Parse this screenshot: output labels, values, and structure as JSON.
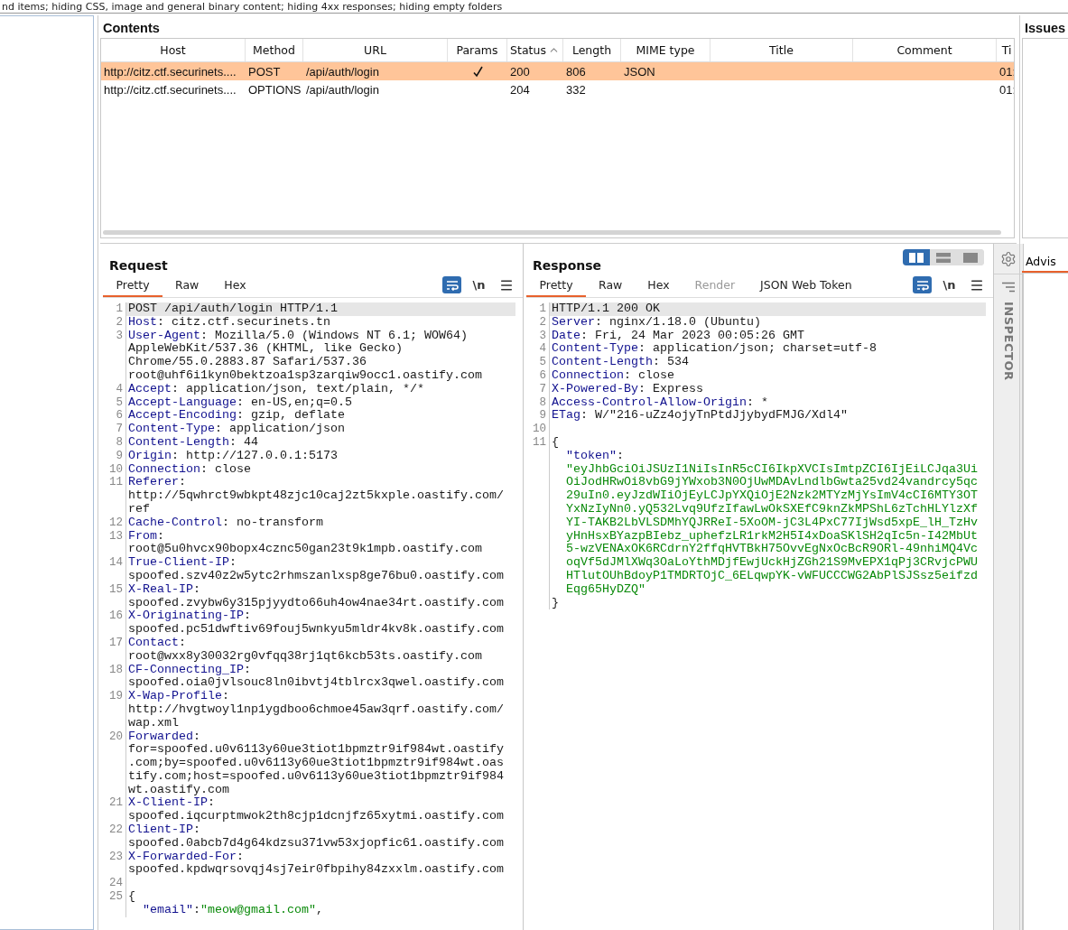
{
  "filter_bar": {
    "text": "nd items;  hiding CSS, image and general binary content;  hiding 4xx responses;  hiding empty folders"
  },
  "contents": {
    "title": "Contents",
    "table": {
      "columns": [
        {
          "label": "Host",
          "sorted": false
        },
        {
          "label": "Method",
          "sorted": false
        },
        {
          "label": "URL",
          "sorted": false
        },
        {
          "label": "Params",
          "sorted": false
        },
        {
          "label": "Status",
          "sorted": true
        },
        {
          "label": "Length",
          "sorted": false
        },
        {
          "label": "MIME type",
          "sorted": false
        },
        {
          "label": "Title",
          "sorted": false
        },
        {
          "label": "Comment",
          "sorted": false
        },
        {
          "label": "Ti",
          "sorted": false
        }
      ],
      "rows": [
        {
          "selected": true,
          "host": "http://citz.ctf.securinets....",
          "method": "POST",
          "url": "/api/auth/login",
          "params": true,
          "status": "200",
          "length": "806",
          "mime_type": "JSON",
          "time": "01:"
        },
        {
          "selected": false,
          "host": "http://citz.ctf.securinets....",
          "method": "OPTIONS",
          "url": "/api/auth/login",
          "params": false,
          "status": "204",
          "length": "332",
          "time": "01:"
        }
      ]
    }
  },
  "issues": {
    "title": "Issues",
    "tab": "Advis"
  },
  "layout_buttons": [
    {
      "kind": "columns",
      "selected": true
    },
    {
      "kind": "rows",
      "selected": false
    },
    {
      "kind": "single",
      "selected": false
    }
  ],
  "request": {
    "title": "Request",
    "tabs": [
      {
        "label": "Pretty",
        "selected": true,
        "disabled": false
      },
      {
        "label": "Raw",
        "selected": false,
        "disabled": false
      },
      {
        "label": "Hex",
        "selected": false,
        "disabled": false
      }
    ],
    "wrap_on": true,
    "newline_label": "\\n",
    "lines": [
      {
        "number": "1",
        "highlighted": true,
        "rows": [
          [
            {
              "kind": "plain",
              "text": "POST /api/auth/login HTTP/1.1"
            }
          ]
        ]
      },
      {
        "number": "2",
        "highlighted": false,
        "rows": [
          [
            {
              "kind": "name",
              "text": "Host"
            },
            {
              "kind": "plain",
              "text": ": citz.ctf.securinets.tn"
            }
          ]
        ]
      },
      {
        "number": "3",
        "highlighted": false,
        "rows": [
          [
            {
              "kind": "name",
              "text": "User-Agent"
            },
            {
              "kind": "plain",
              "text": ": Mozilla/5.0 (Windows NT 6.1; WOW64)"
            }
          ],
          [
            {
              "kind": "plain",
              "text": "AppleWebKit/537.36 (KHTML, like Gecko)"
            }
          ],
          [
            {
              "kind": "plain",
              "text": "Chrome/55.0.2883.87 Safari/537.36"
            }
          ],
          [
            {
              "kind": "plain",
              "text": "root@uhf6i1kyn0bektzoa1sp3zarqiw9occ1.oastify.com"
            }
          ]
        ]
      },
      {
        "number": "4",
        "highlighted": false,
        "rows": [
          [
            {
              "kind": "name",
              "text": "Accept"
            },
            {
              "kind": "plain",
              "text": ": application/json, text/plain, */*"
            }
          ]
        ]
      },
      {
        "number": "5",
        "highlighted": false,
        "rows": [
          [
            {
              "kind": "name",
              "text": "Accept-Language"
            },
            {
              "kind": "plain",
              "text": ": en-US,en;q=0.5"
            }
          ]
        ]
      },
      {
        "number": "6",
        "highlighted": false,
        "rows": [
          [
            {
              "kind": "name",
              "text": "Accept-Encoding"
            },
            {
              "kind": "plain",
              "text": ": gzip, deflate"
            }
          ]
        ]
      },
      {
        "number": "7",
        "highlighted": false,
        "rows": [
          [
            {
              "kind": "name",
              "text": "Content-Type"
            },
            {
              "kind": "plain",
              "text": ": application/json"
            }
          ]
        ]
      },
      {
        "number": "8",
        "highlighted": false,
        "rows": [
          [
            {
              "kind": "name",
              "text": "Content-Length"
            },
            {
              "kind": "plain",
              "text": ": 44"
            }
          ]
        ]
      },
      {
        "number": "9",
        "highlighted": false,
        "rows": [
          [
            {
              "kind": "name",
              "text": "Origin"
            },
            {
              "kind": "plain",
              "text": ": http://127.0.0.1:5173"
            }
          ]
        ]
      },
      {
        "number": "10",
        "highlighted": false,
        "rows": [
          [
            {
              "kind": "name",
              "text": "Connection"
            },
            {
              "kind": "plain",
              "text": ": close"
            }
          ]
        ]
      },
      {
        "number": "11",
        "highlighted": false,
        "rows": [
          [
            {
              "kind": "name",
              "text": "Referer"
            },
            {
              "kind": "plain",
              "text": ":"
            }
          ],
          [
            {
              "kind": "plain",
              "text": "http://5qwhrct9wbkpt48zjc10caj2zt5kxple.oastify.com/"
            }
          ],
          [
            {
              "kind": "plain",
              "text": "ref"
            }
          ]
        ]
      },
      {
        "number": "12",
        "highlighted": false,
        "rows": [
          [
            {
              "kind": "name",
              "text": "Cache-Control"
            },
            {
              "kind": "plain",
              "text": ": no-transform"
            }
          ]
        ]
      },
      {
        "number": "13",
        "highlighted": false,
        "rows": [
          [
            {
              "kind": "name",
              "text": "From"
            },
            {
              "kind": "plain",
              "text": ":"
            }
          ],
          [
            {
              "kind": "plain",
              "text": "root@5u0hvcx90bopx4cznc50gan23t9k1mpb.oastify.com"
            }
          ]
        ]
      },
      {
        "number": "14",
        "highlighted": false,
        "rows": [
          [
            {
              "kind": "name",
              "text": "True-Client-IP"
            },
            {
              "kind": "plain",
              "text": ":"
            }
          ],
          [
            {
              "kind": "plain",
              "text": "spoofed.szv40z2w5ytc2rhmszanlxsp8ge76bu0.oastify.com"
            }
          ]
        ]
      },
      {
        "number": "15",
        "highlighted": false,
        "rows": [
          [
            {
              "kind": "name",
              "text": "X-Real-IP"
            },
            {
              "kind": "plain",
              "text": ":"
            }
          ],
          [
            {
              "kind": "plain",
              "text": "spoofed.zvybw6y315pjyydto66uh4ow4nae34rt.oastify.com"
            }
          ]
        ]
      },
      {
        "number": "16",
        "highlighted": false,
        "rows": [
          [
            {
              "kind": "name",
              "text": "X-Originating-IP"
            },
            {
              "kind": "plain",
              "text": ":"
            }
          ],
          [
            {
              "kind": "plain",
              "text": "spoofed.pc51dwftiv69fouj5wnkyu5mldr4kv8k.oastify.com"
            }
          ]
        ]
      },
      {
        "number": "17",
        "highlighted": false,
        "rows": [
          [
            {
              "kind": "name",
              "text": "Contact"
            },
            {
              "kind": "plain",
              "text": ":"
            }
          ],
          [
            {
              "kind": "plain",
              "text": "root@wxx8y30032rg0vfqq38rj1qt6kcb53ts.oastify.com"
            }
          ]
        ]
      },
      {
        "number": "18",
        "highlighted": false,
        "rows": [
          [
            {
              "kind": "name",
              "text": "CF-Connecting_IP"
            },
            {
              "kind": "plain",
              "text": ":"
            }
          ],
          [
            {
              "kind": "plain",
              "text": "spoofed.oia0jvlsouc8ln0ibvtj4tblrcx3qwel.oastify.com"
            }
          ]
        ]
      },
      {
        "number": "19",
        "highlighted": false,
        "rows": [
          [
            {
              "kind": "name",
              "text": "X-Wap-Profile"
            },
            {
              "kind": "plain",
              "text": ":"
            }
          ],
          [
            {
              "kind": "plain",
              "text": "http://hvgtwoyl1np1ygdboo6chmoe45aw3qrf.oastify.com/"
            }
          ],
          [
            {
              "kind": "plain",
              "text": "wap.xml"
            }
          ]
        ]
      },
      {
        "number": "20",
        "highlighted": false,
        "rows": [
          [
            {
              "kind": "name",
              "text": "Forwarded"
            },
            {
              "kind": "plain",
              "text": ":"
            }
          ],
          [
            {
              "kind": "plain",
              "text": "for=spoofed.u0v6113y60ue3tiot1bpmztr9if984wt.oastify"
            }
          ],
          [
            {
              "kind": "plain",
              "text": ".com;by=spoofed.u0v6113y60ue3tiot1bpmztr9if984wt.oas"
            }
          ],
          [
            {
              "kind": "plain",
              "text": "tify.com;host=spoofed.u0v6113y60ue3tiot1bpmztr9if984"
            }
          ],
          [
            {
              "kind": "plain",
              "text": "wt.oastify.com"
            }
          ]
        ]
      },
      {
        "number": "21",
        "highlighted": false,
        "rows": [
          [
            {
              "kind": "name",
              "text": "X-Client-IP"
            },
            {
              "kind": "plain",
              "text": ":"
            }
          ],
          [
            {
              "kind": "plain",
              "text": "spoofed.iqcurptmwok2th8cjp1dcnjfz65xytmi.oastify.com"
            }
          ]
        ]
      },
      {
        "number": "22",
        "highlighted": false,
        "rows": [
          [
            {
              "kind": "name",
              "text": "Client-IP"
            },
            {
              "kind": "plain",
              "text": ":"
            }
          ],
          [
            {
              "kind": "plain",
              "text": "spoofed.0abcb7d4g64kdzsu371vw53xjopfic61.oastify.com"
            }
          ]
        ]
      },
      {
        "number": "23",
        "highlighted": false,
        "rows": [
          [
            {
              "kind": "name",
              "text": "X-Forwarded-For"
            },
            {
              "kind": "plain",
              "text": ":"
            }
          ],
          [
            {
              "kind": "plain",
              "text": "spoofed.kpdwqrsovqj4sj7eir0fbpihy84zxxlm.oastify.com"
            }
          ]
        ]
      },
      {
        "number": "24",
        "highlighted": false
      },
      {
        "number": "25",
        "highlighted": false,
        "rows": [
          [
            {
              "kind": "plain",
              "text": "{"
            }
          ],
          [
            {
              "kind": "plain",
              "text": "  "
            },
            {
              "kind": "name",
              "text": "\"email\""
            },
            {
              "kind": "plain",
              "text": ":"
            },
            {
              "kind": "string",
              "text": "\"meow@gmail.com\""
            },
            {
              "kind": "plain",
              "text": ","
            }
          ]
        ]
      }
    ]
  },
  "response": {
    "title": "Response",
    "tabs": [
      {
        "label": "Pretty",
        "selected": true,
        "disabled": false
      },
      {
        "label": "Raw",
        "selected": false,
        "disabled": false
      },
      {
        "label": "Hex",
        "selected": false,
        "disabled": false
      },
      {
        "label": "Render",
        "selected": false,
        "disabled": true
      },
      {
        "label": "JSON Web Token",
        "selected": false,
        "disabled": false
      }
    ],
    "wrap_on": true,
    "newline_label": "\\n",
    "lines": [
      {
        "number": "1",
        "highlighted": true,
        "rows": [
          [
            {
              "kind": "plain",
              "text": "HTTP/1.1 200 OK"
            }
          ]
        ]
      },
      {
        "number": "2",
        "highlighted": false,
        "rows": [
          [
            {
              "kind": "name",
              "text": "Server"
            },
            {
              "kind": "plain",
              "text": ": nginx/1.18.0 (Ubuntu)"
            }
          ]
        ]
      },
      {
        "number": "3",
        "highlighted": false,
        "rows": [
          [
            {
              "kind": "name",
              "text": "Date"
            },
            {
              "kind": "plain",
              "text": ": Fri, 24 Mar 2023 00:05:26 GMT"
            }
          ]
        ]
      },
      {
        "number": "4",
        "highlighted": false,
        "rows": [
          [
            {
              "kind": "name",
              "text": "Content-Type"
            },
            {
              "kind": "plain",
              "text": ": application/json; charset=utf-8"
            }
          ]
        ]
      },
      {
        "number": "5",
        "highlighted": false,
        "rows": [
          [
            {
              "kind": "name",
              "text": "Content-Length"
            },
            {
              "kind": "plain",
              "text": ": 534"
            }
          ]
        ]
      },
      {
        "number": "6",
        "highlighted": false,
        "rows": [
          [
            {
              "kind": "name",
              "text": "Connection"
            },
            {
              "kind": "plain",
              "text": ": close"
            }
          ]
        ]
      },
      {
        "number": "7",
        "highlighted": false,
        "rows": [
          [
            {
              "kind": "name",
              "text": "X-Powered-By"
            },
            {
              "kind": "plain",
              "text": ": Express"
            }
          ]
        ]
      },
      {
        "number": "8",
        "highlighted": false,
        "rows": [
          [
            {
              "kind": "name",
              "text": "Access-Control-Allow-Origin"
            },
            {
              "kind": "plain",
              "text": ": *"
            }
          ]
        ]
      },
      {
        "number": "9",
        "highlighted": false,
        "rows": [
          [
            {
              "kind": "name",
              "text": "ETag"
            },
            {
              "kind": "plain",
              "text": ": W/\"216-uZz4ojyTnPtdJjybydFMJG/Xdl4\""
            }
          ]
        ]
      },
      {
        "number": "10",
        "highlighted": false
      },
      {
        "number": "11",
        "highlighted": false,
        "rows": [
          [
            {
              "kind": "plain",
              "text": "{"
            }
          ],
          [
            {
              "kind": "plain",
              "text": "  "
            },
            {
              "kind": "name",
              "text": "\"token\""
            },
            {
              "kind": "plain",
              "text": ":"
            }
          ],
          [
            {
              "kind": "plain",
              "text": "  "
            },
            {
              "kind": "string",
              "text": "\"eyJhbGciOiJSUzI1NiIsInR5cCI6IkpXVCIsImtpZCI6IjEiLCJqa3Ui"
            }
          ],
          [
            {
              "kind": "plain",
              "text": "  "
            },
            {
              "kind": "string",
              "text": "OiJodHRwOi8vbG9jYWxob3N0OjUwMDAvLndlbGwta25vd24vandrcy5qc"
            }
          ],
          [
            {
              "kind": "plain",
              "text": "  "
            },
            {
              "kind": "string",
              "text": "29uIn0.eyJzdWIiOjEyLCJpYXQiOjE2Nzk2MTYzMjYsImV4cCI6MTY3OT"
            }
          ],
          [
            {
              "kind": "plain",
              "text": "  "
            },
            {
              "kind": "string",
              "text": "YxNzIyNn0.yQ532Lvq9UfzIfawLwOkSXEfC9knZkMPShL6zTchHLYlzXf"
            }
          ],
          [
            {
              "kind": "plain",
              "text": "  "
            },
            {
              "kind": "string",
              "text": "YI-TAKB2LbVLSDMhYQJRReI-5XoOM-jC3L4PxC77IjWsd5xpE_lH_TzHv"
            }
          ],
          [
            {
              "kind": "plain",
              "text": "  "
            },
            {
              "kind": "string",
              "text": "yHnHsxBYazpBIebz_uphefzLR1rkM2H5I4xDoaSKlSH2qIc5n-I42MbUt"
            }
          ],
          [
            {
              "kind": "plain",
              "text": "  "
            },
            {
              "kind": "string",
              "text": "5-wzVENAxOK6RCdrnY2ffqHVTBkH75OvvEgNxOcBcR9ORl-49nhiMQ4Vc"
            }
          ],
          [
            {
              "kind": "plain",
              "text": "  "
            },
            {
              "kind": "string",
              "text": "oqVf5dJMlXWq3OaLoYthMDjfEwjUckHjZGh21S9MvEPX1qPj3CRvjcPWU"
            }
          ],
          [
            {
              "kind": "plain",
              "text": "  "
            },
            {
              "kind": "string",
              "text": "HTlutOUhBdoyP1TMDRTOjC_6ELqwpYK-vWFUCCCWG2AbPlSJSsz5eifzd"
            }
          ],
          [
            {
              "kind": "plain",
              "text": "  "
            },
            {
              "kind": "string",
              "text": "Eqg65HyDZQ\""
            }
          ],
          [
            {
              "kind": "plain",
              "text": "}"
            }
          ]
        ]
      }
    ]
  },
  "inspector": {
    "label": "INSPECTOR"
  }
}
